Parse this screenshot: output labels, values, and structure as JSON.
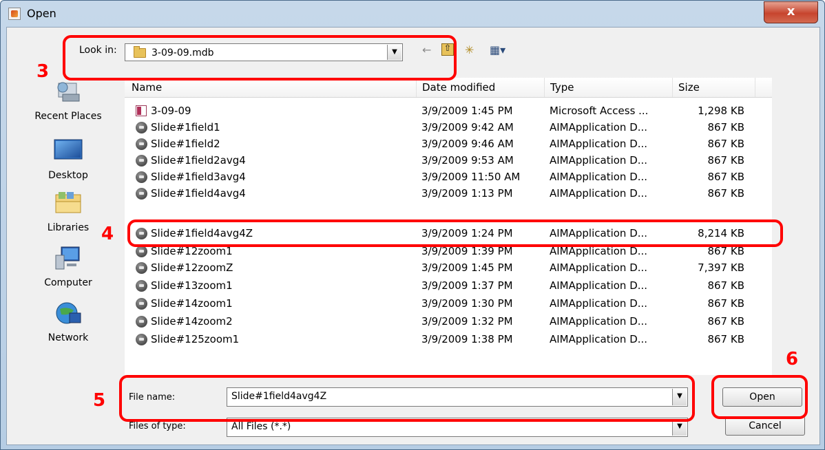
{
  "window": {
    "title": "Open",
    "close_glyph": "x"
  },
  "lookin": {
    "label": "Look in:",
    "value": "3-09-09.mdb",
    "dropdown_glyph": "▼"
  },
  "toolbar": {
    "back_glyph": "←",
    "up_folder_glyph": "⇧",
    "new_folder_glyph": "✳",
    "view_menu_glyph": "▦▾"
  },
  "places": [
    {
      "label": "Recent Places",
      "icon": "recent-places-icon"
    },
    {
      "label": "Desktop",
      "icon": "desktop-icon"
    },
    {
      "label": "Libraries",
      "icon": "libraries-icon"
    },
    {
      "label": "Computer",
      "icon": "computer-icon"
    },
    {
      "label": "Network",
      "icon": "network-icon"
    }
  ],
  "columns": [
    "Name",
    "Date modified",
    "Type",
    "Size"
  ],
  "files": [
    {
      "name": "3-09-09",
      "date": "3/9/2009 1:45 PM",
      "type": "Microsoft Access ...",
      "size": "1,298 KB",
      "icon": "access-file-icon"
    },
    {
      "name": "Slide#1field1",
      "date": "3/9/2009 9:42 AM",
      "type": "AIMApplication D...",
      "size": "867 KB",
      "icon": "aim-file-icon"
    },
    {
      "name": "Slide#1field2",
      "date": "3/9/2009 9:46 AM",
      "type": "AIMApplication D...",
      "size": "867 KB",
      "icon": "aim-file-icon"
    },
    {
      "name": "Slide#1field2avg4",
      "date": "3/9/2009 9:53 AM",
      "type": "AIMApplication D...",
      "size": "867 KB",
      "icon": "aim-file-icon"
    },
    {
      "name": "Slide#1field3avg4",
      "date": "3/9/2009 11:50 AM",
      "type": "AIMApplication D...",
      "size": "867 KB",
      "icon": "aim-file-icon"
    },
    {
      "name": "Slide#1field4avg4",
      "date": "3/9/2009 1:13 PM",
      "type": "AIMApplication D...",
      "size": "867 KB",
      "icon": "aim-file-icon"
    },
    {
      "name": "Slide#1field4avg4Z",
      "date": "3/9/2009 1:24 PM",
      "type": "AIMApplication D...",
      "size": "8,214 KB",
      "icon": "aim-file-icon"
    },
    {
      "name": "Slide#12zoom1",
      "date": "3/9/2009 1:39 PM",
      "type": "AIMApplication D...",
      "size": "867 KB",
      "icon": "aim-file-icon"
    },
    {
      "name": "Slide#12zoomZ",
      "date": "3/9/2009 1:45 PM",
      "type": "AIMApplication D...",
      "size": "7,397 KB",
      "icon": "aim-file-icon"
    },
    {
      "name": "Slide#13zoom1",
      "date": "3/9/2009 1:37 PM",
      "type": "AIMApplication D...",
      "size": "867 KB",
      "icon": "aim-file-icon"
    },
    {
      "name": "Slide#14zoom1",
      "date": "3/9/2009 1:30 PM",
      "type": "AIMApplication D...",
      "size": "867 KB",
      "icon": "aim-file-icon"
    },
    {
      "name": "Slide#14zoom2",
      "date": "3/9/2009 1:32 PM",
      "type": "AIMApplication D...",
      "size": "867 KB",
      "icon": "aim-file-icon"
    },
    {
      "name": "Slide#125zoom1",
      "date": "3/9/2009 1:38 PM",
      "type": "AIMApplication D...",
      "size": "867 KB",
      "icon": "aim-file-icon"
    }
  ],
  "filename": {
    "label": "File name:",
    "value": "Slide#1field4avg4Z",
    "dropdown_glyph": "▼"
  },
  "filetype": {
    "label": "Files of type:",
    "value": "All Files (*.*)",
    "dropdown_glyph": "▼"
  },
  "buttons": {
    "open": "Open",
    "cancel": "Cancel"
  },
  "annotations": [
    "3",
    "4",
    "5",
    "6"
  ],
  "colors": {
    "annotation": "#ff0000",
    "titlebar": "#c6d8ea",
    "close": "#c7452e"
  }
}
